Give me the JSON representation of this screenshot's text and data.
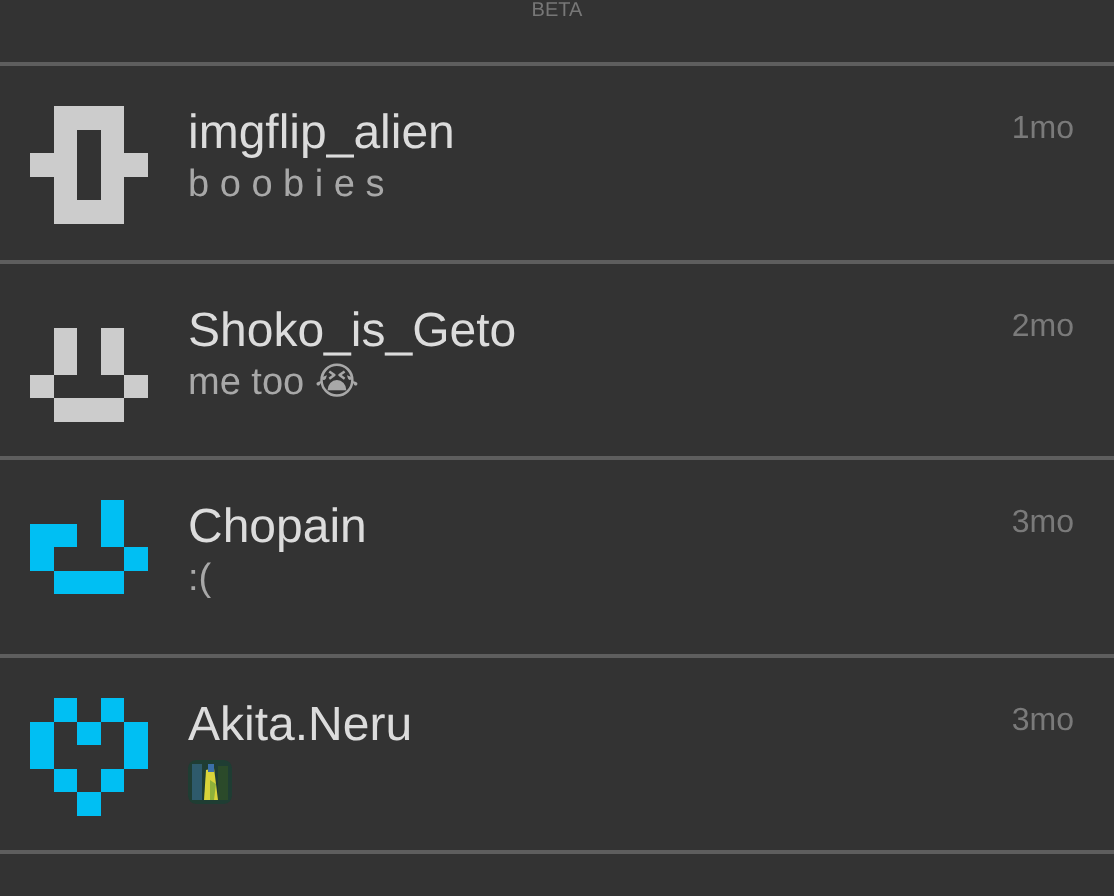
{
  "header": {
    "label": "BETA"
  },
  "conversations": [
    {
      "avatar": {
        "kind": "bar",
        "color": "#cccccc"
      },
      "name": "imgflip_alien",
      "message": "b o o b i e s",
      "time": "1mo"
    },
    {
      "avatar": {
        "kind": "smile",
        "color": "#cccccc"
      },
      "name": "Shoko_is_Geto",
      "message": "me too 😭",
      "time": "2mo"
    },
    {
      "avatar": {
        "kind": "wink",
        "color": "#00bff3"
      },
      "name": "Chopain",
      "message": ":(",
      "time": "3mo"
    },
    {
      "avatar": {
        "kind": "heart",
        "color": "#00bff3"
      },
      "name": "Akita.Neru",
      "time": "3mo"
    }
  ]
}
